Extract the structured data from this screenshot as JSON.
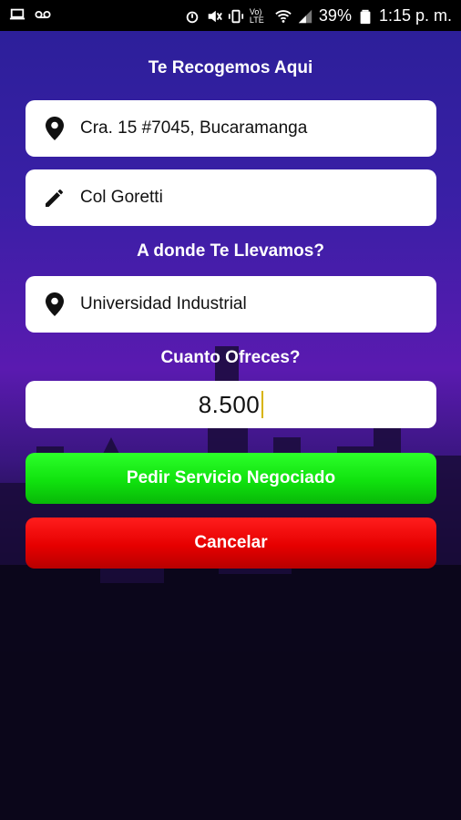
{
  "status_bar": {
    "battery": "39%",
    "time": "1:15 p. m.",
    "volte_label": "Vo) LTE"
  },
  "pickup": {
    "title": "Te Recogemos Aqui",
    "address": "Cra. 15 #7045,  Bucaramanga",
    "reference": "Col Goretti",
    "address_icon": "location-pin-icon",
    "reference_icon": "pencil-icon"
  },
  "destination": {
    "title": "A donde Te Llevamos?",
    "place": "Universidad Industrial",
    "icon": "location-pin-icon"
  },
  "offer": {
    "title": "Cuanto Ofreces?",
    "value": "8.500"
  },
  "buttons": {
    "request_label": "Pedir Servicio Negociado",
    "cancel_label": "Cancelar"
  },
  "colors": {
    "request": "#18e016",
    "cancel": "#e60000",
    "background_top": "#2a1f98"
  }
}
